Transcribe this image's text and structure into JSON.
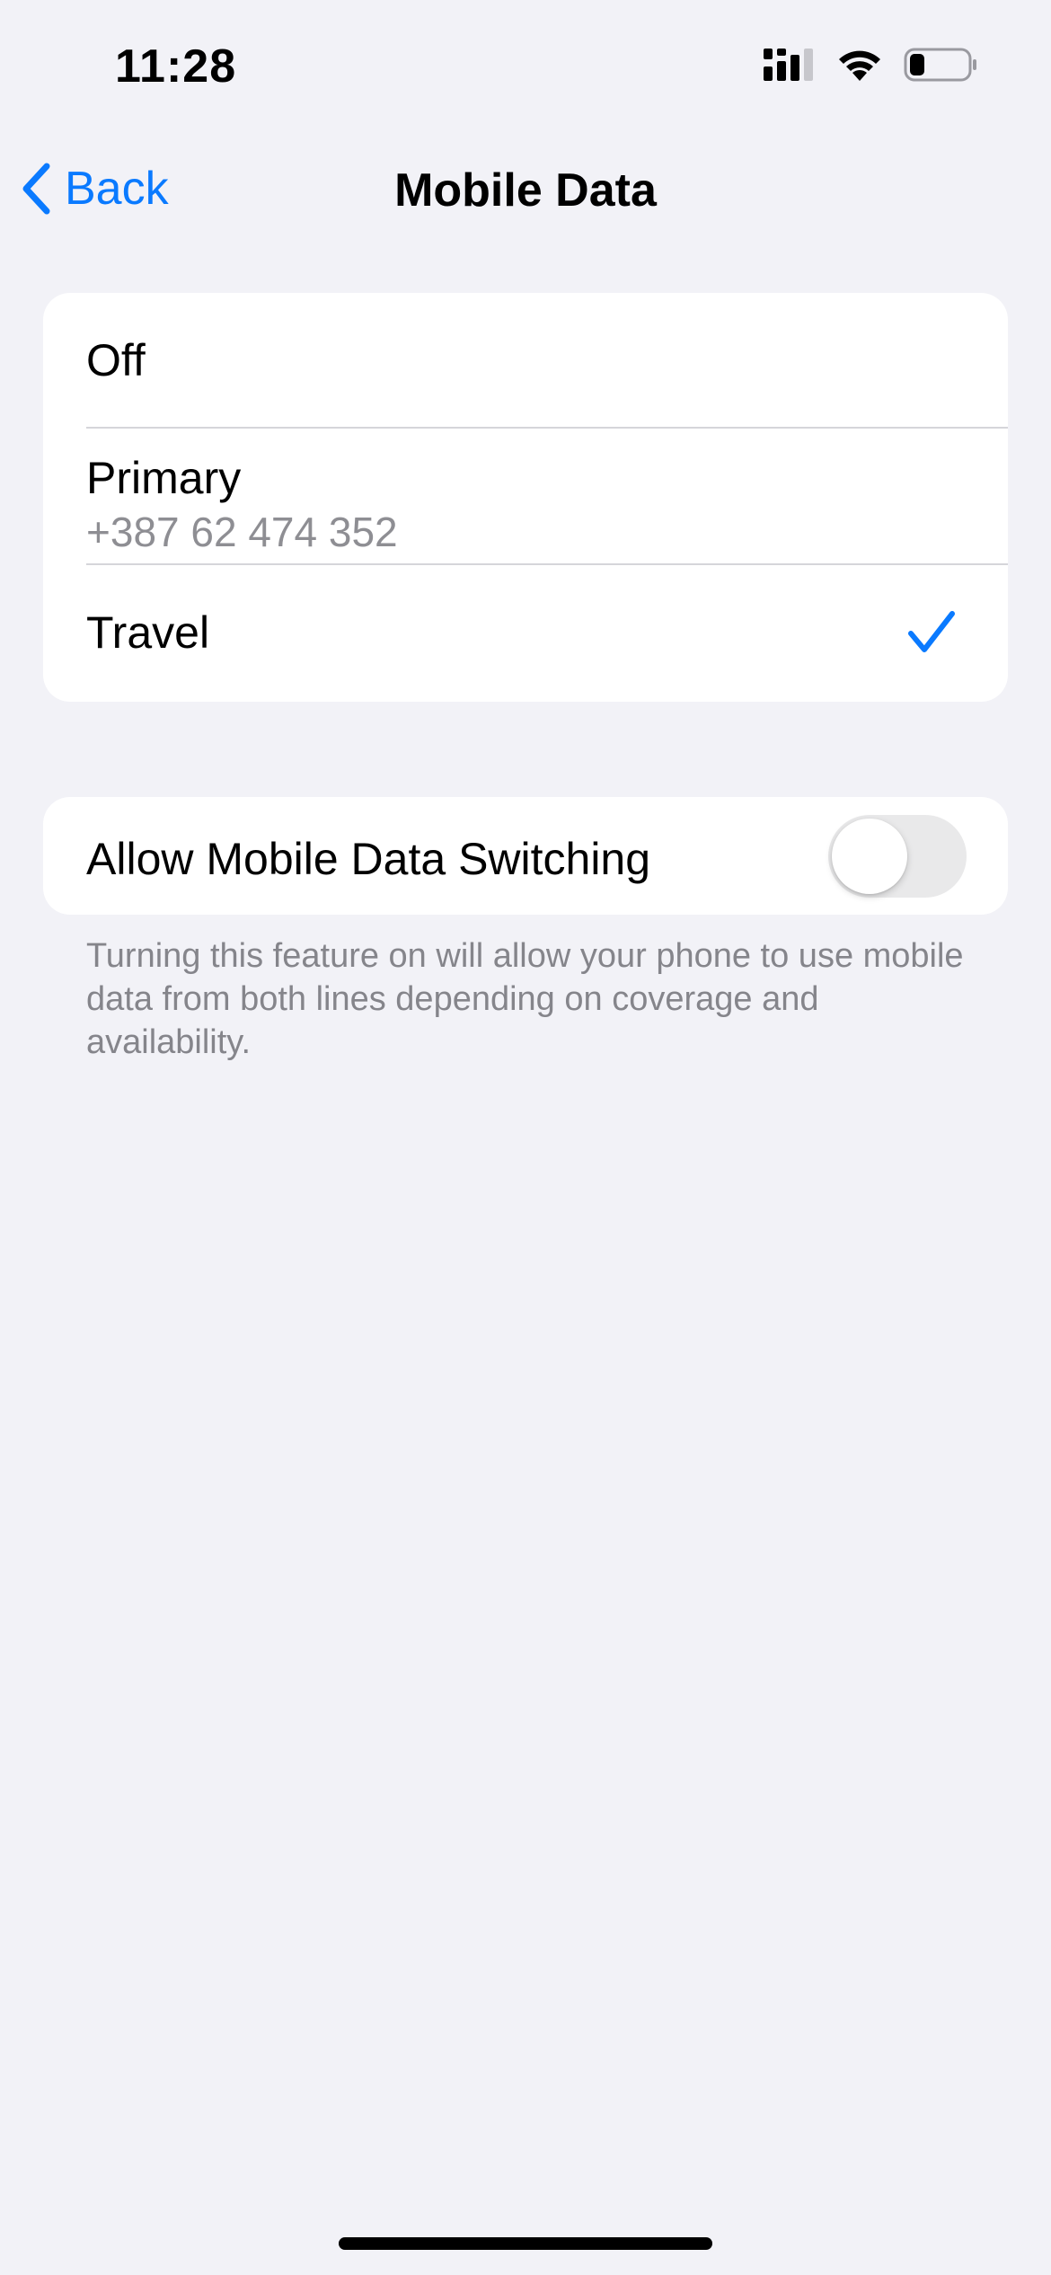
{
  "status_bar": {
    "time": "11:28",
    "icons": [
      "cellular-signal-icon",
      "wifi-icon",
      "battery-icon"
    ],
    "battery_level": 0.25
  },
  "nav": {
    "back_label": "Back",
    "title": "Mobile Data"
  },
  "options": [
    {
      "label": "Off",
      "subtitle": "",
      "selected": false
    },
    {
      "label": "Primary",
      "subtitle": "+387 62 474 352",
      "selected": false
    },
    {
      "label": "Travel",
      "subtitle": "",
      "selected": true
    }
  ],
  "switching": {
    "label": "Allow Mobile Data Switching",
    "enabled": false,
    "footer": "Turning this feature on will allow your phone to use mobile data from both lines depending on coverage and availability."
  },
  "colors": {
    "accent": "#0a7aff",
    "background": "#f2f2f7",
    "secondary_text": "#8e8e93"
  }
}
